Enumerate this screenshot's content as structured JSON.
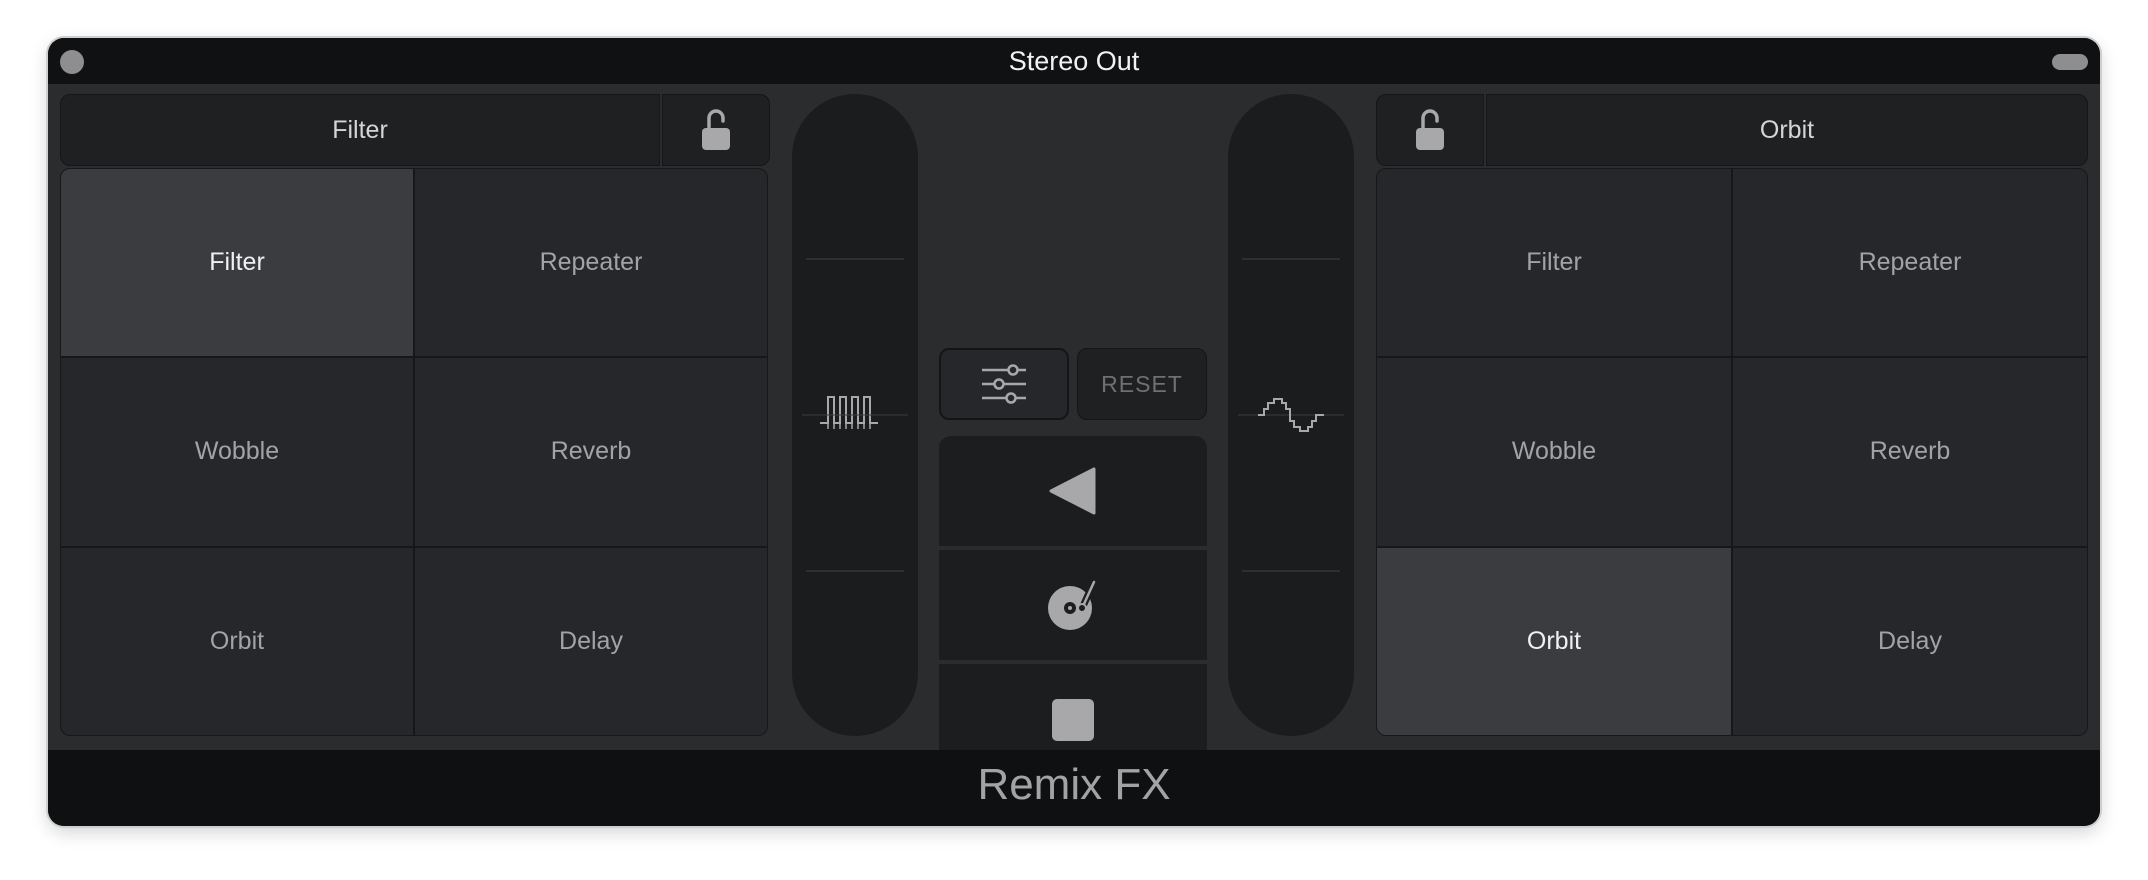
{
  "window": {
    "title": "Stereo Out",
    "footer_title": "Remix FX"
  },
  "left_panel": {
    "header_label": "Filter",
    "lock_icon": "unlocked-padlock-icon",
    "effects": [
      {
        "label": "Filter",
        "active": true
      },
      {
        "label": "Repeater",
        "active": false
      },
      {
        "label": "Wobble",
        "active": false
      },
      {
        "label": "Reverb",
        "active": false
      },
      {
        "label": "Orbit",
        "active": false
      },
      {
        "label": "Delay",
        "active": false
      }
    ]
  },
  "right_panel": {
    "header_label": "Orbit",
    "lock_icon": "unlocked-padlock-icon",
    "effects": [
      {
        "label": "Filter",
        "active": false
      },
      {
        "label": "Repeater",
        "active": false
      },
      {
        "label": "Wobble",
        "active": false
      },
      {
        "label": "Reverb",
        "active": false
      },
      {
        "label": "Orbit",
        "active": true
      },
      {
        "label": "Delay",
        "active": false
      }
    ]
  },
  "center": {
    "left_fader_icon": "square-wave-icon",
    "right_fader_icon": "sine-wave-icon",
    "settings_icon": "sliders-icon",
    "reset_label": "RESET",
    "transport": {
      "reverse_icon": "reverse-play-icon",
      "scratch_icon": "turntable-record-icon",
      "stop_icon": "stop-icon"
    }
  },
  "colors": {
    "background": "#2a2c2e",
    "titlebar": "#101112",
    "cell": "#25272a",
    "cell_active": "#3b3c40",
    "icon": "#a8a8aa"
  }
}
